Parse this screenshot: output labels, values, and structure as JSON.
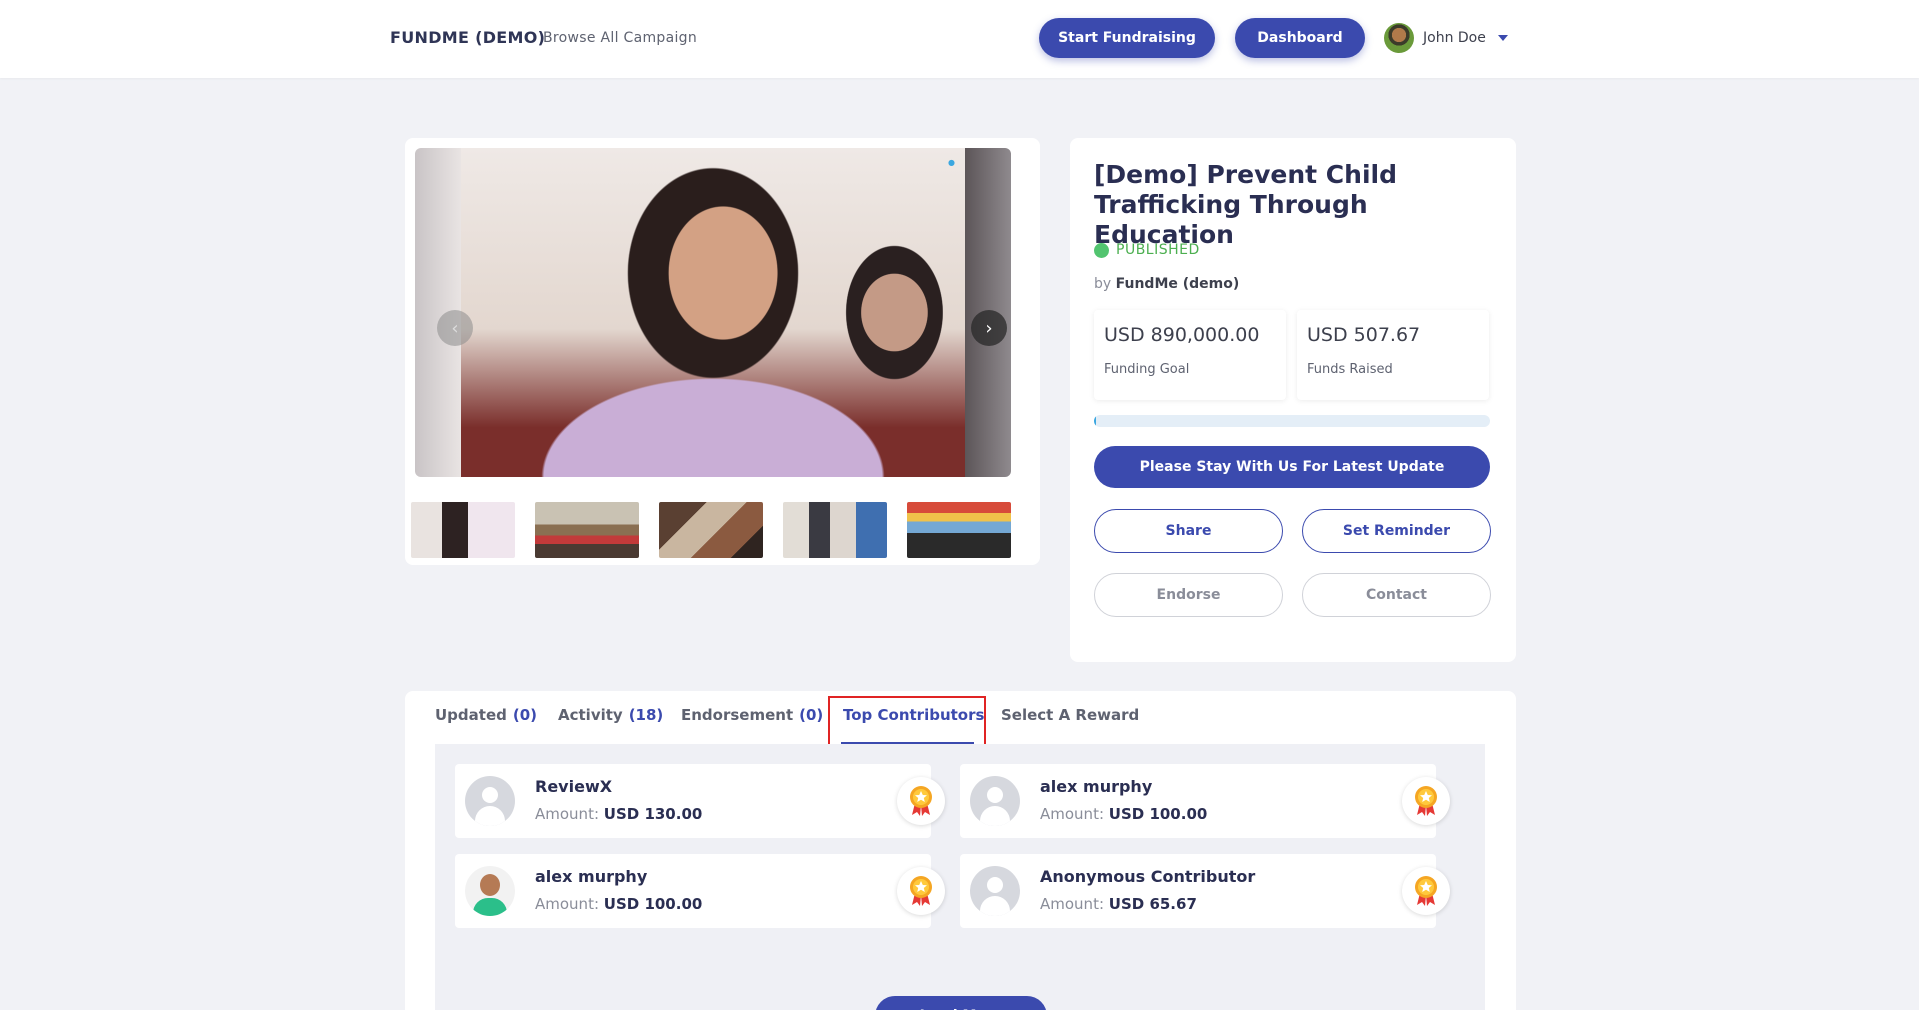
{
  "header": {
    "brand": "FUNDME (DEMO)",
    "browse": "Browse All Campaign",
    "start_label": "Start Fundraising",
    "dashboard_label": "Dashboard",
    "user_name": "John Doe"
  },
  "campaign": {
    "title": "[Demo] Prevent Child Trafficking Through Education",
    "status": "PUBLISHED",
    "by_prefix": "by",
    "by_name": "FundMe (demo)",
    "goal_value": "USD 890,000.00",
    "goal_label": "Funding Goal",
    "raised_value": "USD 507.67",
    "raised_label": "Funds Raised",
    "progress_fraction": 0.0006,
    "stay_label": "Please Stay With Us For Latest Update",
    "share_label": "Share",
    "reminder_label": "Set Reminder",
    "endorse_label": "Endorse",
    "contact_label": "Contact"
  },
  "tabs": [
    {
      "label": "Updated",
      "count": "(0)"
    },
    {
      "label": "Activity",
      "count": "(18)"
    },
    {
      "label": "Endorsement",
      "count": "(0)"
    },
    {
      "label": "Top Contributors"
    },
    {
      "label": "Select A Reward"
    }
  ],
  "contributors": [
    {
      "name": "ReviewX",
      "amount_label": "Amount:",
      "amount": "USD 130.00"
    },
    {
      "name": "alex murphy",
      "amount_label": "Amount:",
      "amount": "USD 100.00"
    },
    {
      "name": "alex murphy",
      "amount_label": "Amount:",
      "amount": "USD 100.00"
    },
    {
      "name": "Anonymous Contributor",
      "amount_label": "Amount:",
      "amount": "USD 65.67"
    }
  ],
  "load_more_label": "Load More",
  "colors": {
    "accent": "#3b4aae",
    "published": "#4caf50",
    "highlight": "#e02424"
  }
}
